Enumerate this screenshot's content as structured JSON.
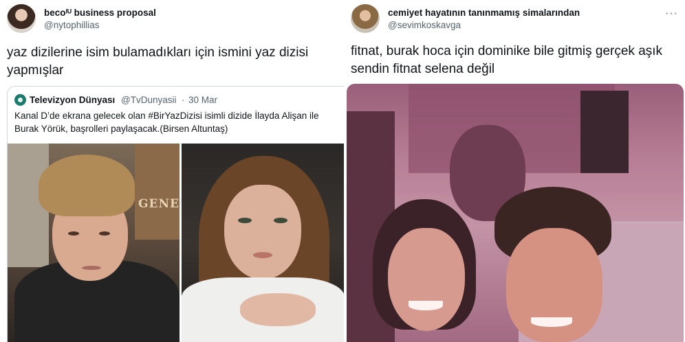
{
  "left_tweet": {
    "author": {
      "name": "becoᴵᵁ business proposal",
      "handle": "@nytophillias"
    },
    "text": "yaz dizilerine isim bulamadıkları için ismini yaz dizisi yapmışlar",
    "quoted": {
      "author_name": "Televizyon Dünyası",
      "author_handle": "@TvDunyasii",
      "separator": "·",
      "date": "30 Mar",
      "text": "Kanal D’de ekrana gelecek olan #BirYazDizisi isimli dizide İlayda Alişan ile Burak Yörük, başrolleri paylaşacak.(Birsen Altuntaş)",
      "photo_sign_text": "GENERA"
    }
  },
  "right_tweet": {
    "author": {
      "name": "cemiyet hayatının tanınmamış simalarından",
      "handle": "@sevimkoskavga"
    },
    "more_icon": "···",
    "text": "fitnat, burak hoca için dominike bile gitmiş gerçek aşık sendin fitnat selena değil"
  },
  "colors": {
    "text_primary": "#0f1419",
    "text_secondary": "#536471",
    "border": "#cfd9de"
  }
}
